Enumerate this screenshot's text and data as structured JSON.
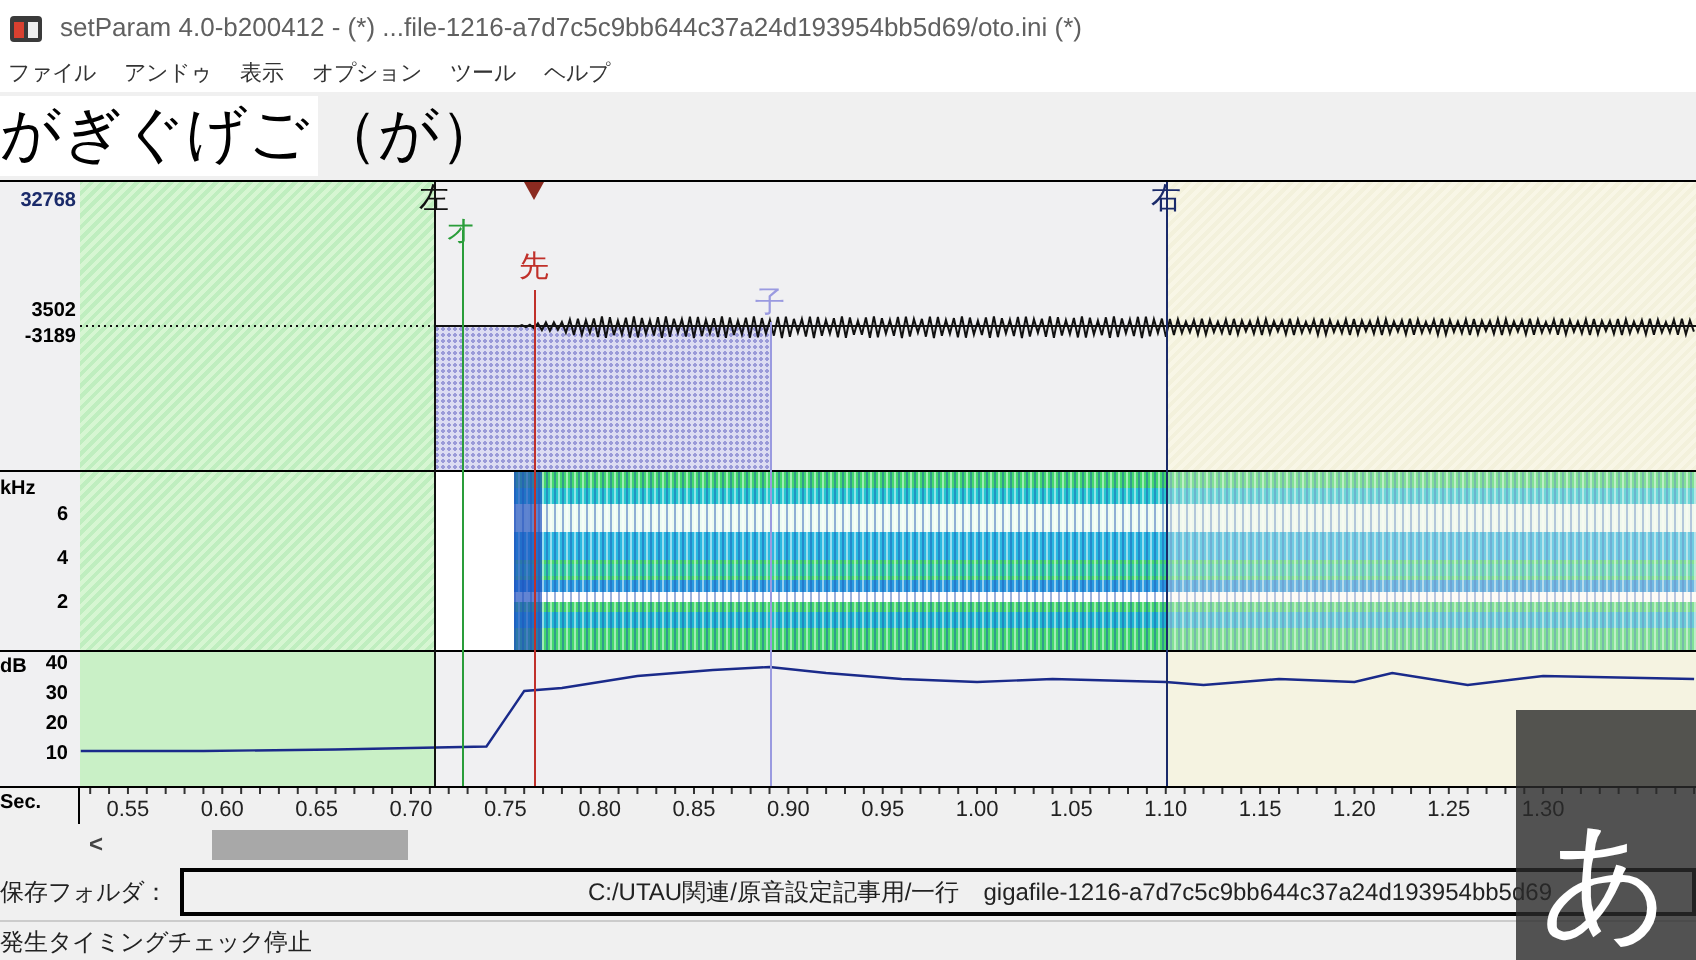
{
  "window": {
    "title": "setParam 4.0-b200412 - (*) ...file-1216-a7d7c5c9bb644c37a24d193954bb5d69/oto.ini (*)"
  },
  "menu": [
    "ファイル",
    "アンドゥ",
    "表示",
    "オプション",
    "ツール",
    "ヘルプ"
  ],
  "heading": {
    "aliases": "がぎぐげご",
    "current": "（が）"
  },
  "waveform": {
    "yticks": [
      "32768",
      "3502",
      "-3189"
    ]
  },
  "spectrogram": {
    "unit": "kHz",
    "ticks": [
      "6",
      "4",
      "2"
    ]
  },
  "power": {
    "chart_data": {
      "type": "line",
      "xlabel": "Sec.",
      "ylabel": "dB",
      "x": [
        0.525,
        0.59,
        0.66,
        0.7,
        0.74,
        0.76,
        0.78,
        0.82,
        0.86,
        0.89,
        0.92,
        0.96,
        1.0,
        1.04,
        1.1,
        1.12,
        1.16,
        1.2,
        1.22,
        1.26,
        1.3,
        1.38
      ],
      "series": [
        {
          "color": "#1a2a8a",
          "values": [
            11,
            11,
            11.5,
            12,
            12.5,
            31,
            32,
            36,
            38,
            39,
            37,
            35,
            34,
            35,
            34,
            33,
            35,
            34,
            37,
            33,
            36,
            35
          ]
        }
      ],
      "xlim": [
        0.4822,
        1.381
      ],
      "ylim": [
        0,
        44
      ],
      "yticks": [
        40,
        30,
        20,
        10
      ],
      "xticks": [
        {
          "value": 0.55,
          "label": "0.55"
        },
        {
          "value": 0.6,
          "label": "0.60"
        },
        {
          "value": 0.65,
          "label": "0.65"
        },
        {
          "value": 0.7,
          "label": "0.70"
        },
        {
          "value": 0.75,
          "label": "0.75"
        },
        {
          "value": 0.8,
          "label": "0.80"
        },
        {
          "value": 0.85,
          "label": "0.85"
        },
        {
          "value": 0.9,
          "label": "0.90"
        },
        {
          "value": 0.95,
          "label": "0.95"
        },
        {
          "value": 1.0,
          "label": "1.00"
        },
        {
          "value": 1.05,
          "label": "1.05"
        },
        {
          "value": 1.1,
          "label": "1.10"
        },
        {
          "value": 1.15,
          "label": "1.15"
        },
        {
          "value": 1.2,
          "label": "1.20"
        },
        {
          "value": 1.25,
          "label": "1.25"
        },
        {
          "value": 1.3,
          "label": "1.30"
        }
      ]
    }
  },
  "markers": [
    {
      "label": "左",
      "kind": "offset",
      "level": 0.219
    },
    {
      "label": "オ",
      "kind": "overlap",
      "level": 0.236
    },
    {
      "label": "先",
      "kind": "preutterance",
      "level": 0.281
    },
    {
      "label": "子",
      "kind": "consonant",
      "level": 0.427
    },
    {
      "label": "右",
      "kind": "cutoff",
      "level": 0.672
    }
  ],
  "playhead": {
    "level": 0.281
  },
  "scrollbar": {
    "arrow": "<"
  },
  "save_folder": {
    "label": "保存フォルダ：",
    "value": "C:/UTAU関連/原音設定記事用/一行　gigafile-1216-a7d7c5c9bb644c37a24d193954bb5d69"
  },
  "status_bar": "発生タイミングチェック停止",
  "ime_indicator": "あ"
}
